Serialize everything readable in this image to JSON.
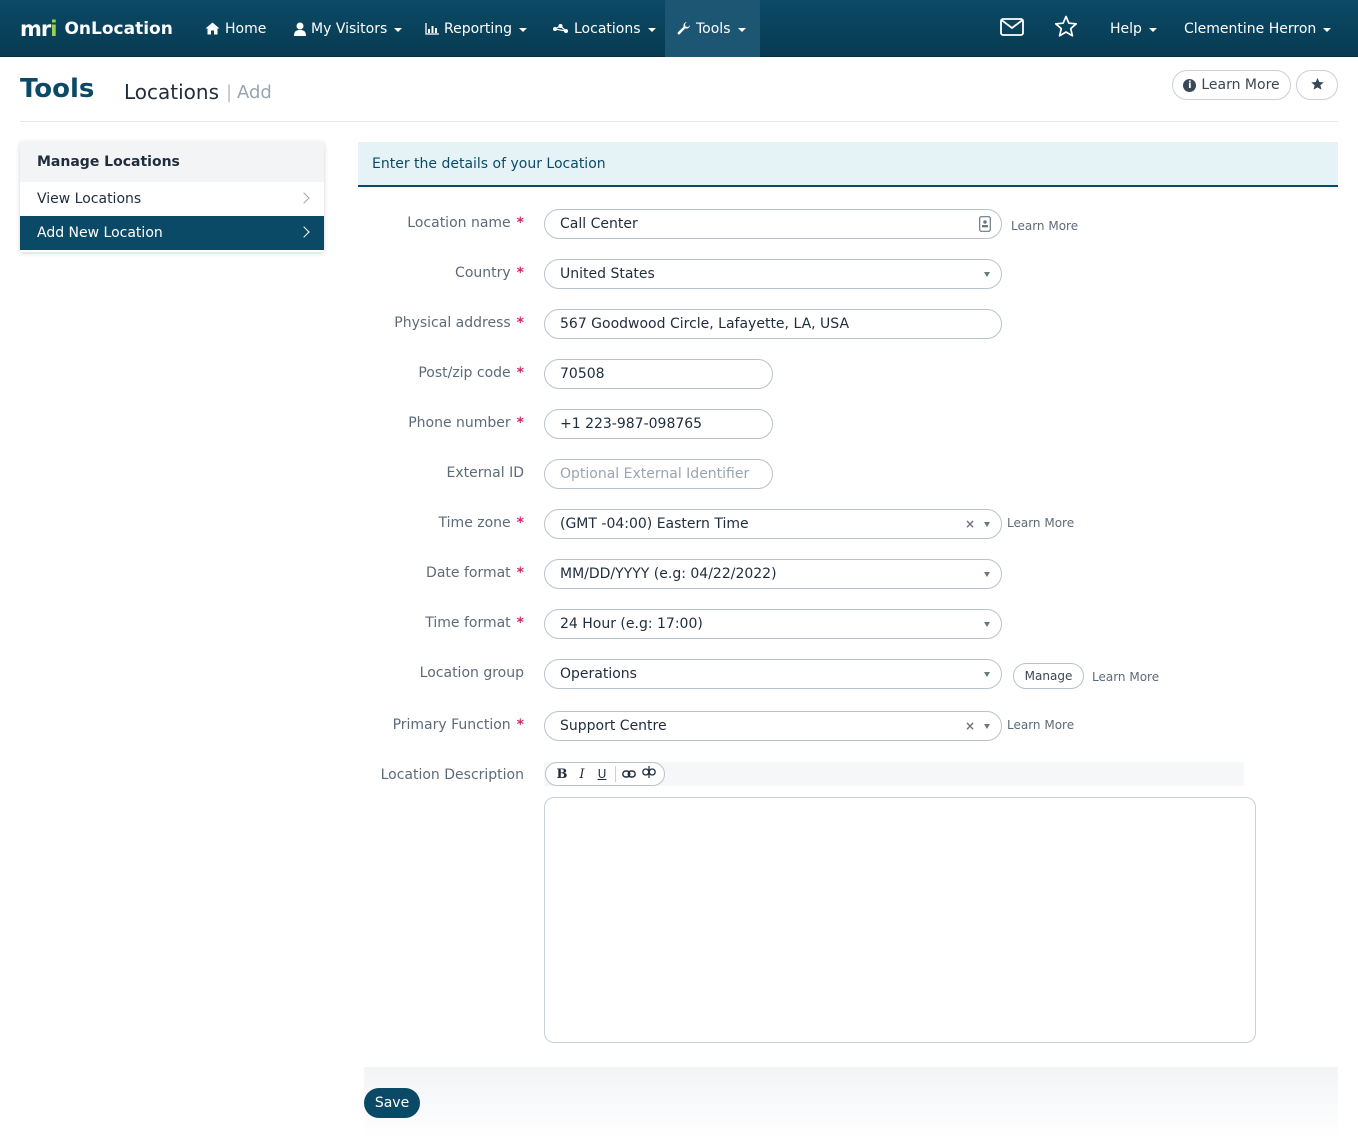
{
  "brand": {
    "mark_main": "mr",
    "mark_accent": "i",
    "name": "OnLocation"
  },
  "nav": {
    "home": "Home",
    "my_visitors": "My Visitors",
    "reporting": "Reporting",
    "locations": "Locations",
    "tools": "Tools",
    "help": "Help",
    "user": "Clementine Herron"
  },
  "header": {
    "title": "Tools",
    "section": "Locations",
    "separator": "|",
    "subsection": "Add",
    "learn_more": "Learn More"
  },
  "side_menu": {
    "heading": "Manage Locations",
    "items": [
      "View Locations",
      "Add New Location"
    ]
  },
  "form": {
    "heading": "Enter the details of your Location",
    "required_mark": "*",
    "location_name": {
      "label": "Location name",
      "value": "Call Center",
      "learn_more": "Learn More"
    },
    "country": {
      "label": "Country",
      "value": "United States"
    },
    "physical_address": {
      "label": "Physical address",
      "value": "567 Goodwood Circle, Lafayette, LA, USA"
    },
    "post_code": {
      "label": "Post/zip code",
      "value": "70508"
    },
    "phone": {
      "label": "Phone number",
      "value": "+1 223-987-098765"
    },
    "external_id": {
      "label": "External ID",
      "placeholder": "Optional External Identifier"
    },
    "time_zone": {
      "label": "Time zone",
      "value": "(GMT -04:00) Eastern Time",
      "learn_more": "Learn More"
    },
    "date_format": {
      "label": "Date format",
      "value": "MM/DD/YYYY (e.g: 04/22/2022)"
    },
    "time_format": {
      "label": "Time format",
      "value": "24 Hour (e.g: 17:00)"
    },
    "location_group": {
      "label": "Location group",
      "value": "Operations",
      "manage": "Manage",
      "learn_more": "Learn More"
    },
    "primary_function": {
      "label": "Primary Function",
      "value": "Support Centre",
      "learn_more": "Learn More"
    },
    "description": {
      "label": "Location Description"
    },
    "clear_mark": "×",
    "toolbar": {
      "bold": "B",
      "italic": "I",
      "underline": "U"
    },
    "save": "Save"
  },
  "colors": {
    "primary": "#0b4a66",
    "accent_green": "#9bd14a",
    "required": "#d6246e",
    "panel_bg": "#e6f3f6"
  },
  "icons": [
    "home-icon",
    "user-icon",
    "chart-icon",
    "nodes-icon",
    "wrench-icon",
    "mail-icon",
    "star-icon",
    "info-icon",
    "contact-card-icon",
    "link-icon",
    "unlink-icon",
    "chevron-right-icon"
  ]
}
